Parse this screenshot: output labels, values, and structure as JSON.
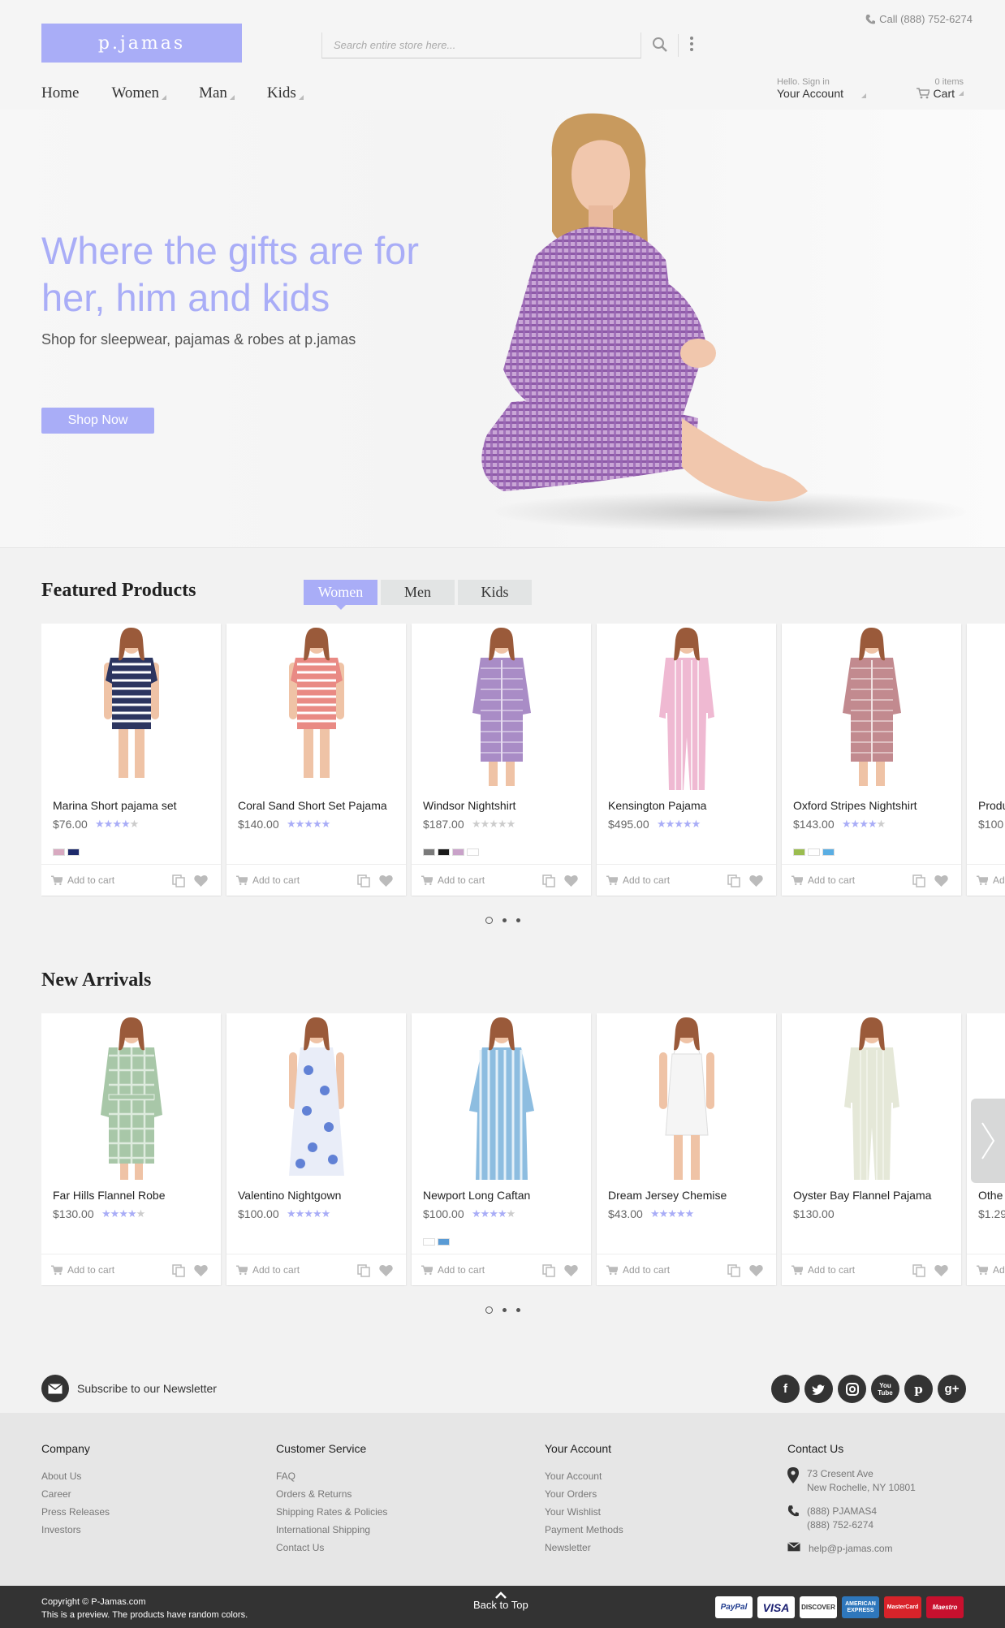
{
  "header": {
    "logo": "p.jamas",
    "search_placeholder": "Search entire store here...",
    "phone": "Call (888) 752-6274",
    "nav": [
      "Home",
      "Women",
      "Man",
      "Kids"
    ],
    "account_small": "Hello. Sign in",
    "account_label": "Your Account",
    "cart_count": "0 items",
    "cart_label": "Cart"
  },
  "hero": {
    "title": "Where the gifts are for her, him and kids",
    "subtitle": "Shop for sleepwear, pajamas & robes at p.jamas",
    "button": "Shop Now"
  },
  "featured": {
    "title": "Featured Products",
    "tabs": [
      "Women",
      "Men",
      "Kids"
    ],
    "active_tab": "Women",
    "products": [
      {
        "name": "Marina Short pajama set",
        "price": "$76.00",
        "rating": 4,
        "swatches": [
          "#d8a9c0",
          "#1d2a6b"
        ],
        "garment": "#2c3560",
        "accent": "#ffffff",
        "style": "shorts"
      },
      {
        "name": "Coral Sand Short Set Pajama",
        "price": "$140.00",
        "rating": 5,
        "swatches": [],
        "garment": "#e98a84",
        "accent": "#ffffff",
        "style": "shorts"
      },
      {
        "name": "Windsor Nightshirt",
        "price": "$187.00",
        "rating": 0,
        "swatches": [
          "#7a7a7a",
          "#1a1a1a",
          "#c9a2c9",
          "#ffffff"
        ],
        "garment": "#a98cc6",
        "accent": "#e6dbf0",
        "style": "shirt"
      },
      {
        "name": "Kensington Pajama",
        "price": "$495.00",
        "rating": 5,
        "swatches": [],
        "garment": "#efb9d2",
        "accent": "#ffffff",
        "style": "pajama"
      },
      {
        "name": "Oxford Stripes Nightshirt",
        "price": "$143.00",
        "rating": 4,
        "swatches": [
          "#9bbd4f",
          "#ffffff",
          "#5aaee3"
        ],
        "garment": "#c28a8f",
        "accent": "#f1e2e2",
        "style": "shirt"
      },
      {
        "name": "Produ",
        "price": "$100",
        "rating": 0,
        "swatches": [],
        "garment": "#dddddd",
        "accent": "#ffffff",
        "style": "none"
      }
    ]
  },
  "new_arrivals": {
    "title": "New Arrivals",
    "products": [
      {
        "name": "Far Hills Flannel Robe",
        "price": "$130.00",
        "rating": 4,
        "swatches": [],
        "garment": "#a8c7a8",
        "accent": "#e4efe4",
        "style": "robe"
      },
      {
        "name": "Valentino Nightgown",
        "price": "$100.00",
        "rating": 5,
        "swatches": [],
        "garment": "#e9edf8",
        "accent": "#4a6fd0",
        "style": "gown"
      },
      {
        "name": "Newport Long Caftan",
        "price": "$100.00",
        "rating": 4,
        "swatches": [
          "#ffffff",
          "#5a9bd5"
        ],
        "garment": "#8dbde0",
        "accent": "#e4f0f8",
        "style": "caftan"
      },
      {
        "name": "Dream Jersey Chemise",
        "price": "$43.00",
        "rating": 5,
        "swatches": [],
        "garment": "#f5f5f5",
        "accent": "#dddddd",
        "style": "chemise"
      },
      {
        "name": "Oyster Bay Flannel Pajama",
        "price": "$130.00",
        "rating": 0,
        "swatches": [],
        "garment": "#e5e8d8",
        "accent": "#f5f6ee",
        "style": "pajama"
      },
      {
        "name": "Othe",
        "price": "$1.29",
        "rating": 0,
        "swatches": [],
        "garment": "#dddddd",
        "accent": "#ffffff",
        "style": "none"
      }
    ]
  },
  "add_to_cart": "Add to cart",
  "newsletter": "Subscribe to our Newsletter",
  "social": [
    "facebook-icon",
    "twitter-icon",
    "instagram-icon",
    "youtube-icon",
    "pinterest-icon",
    "google-plus-icon"
  ],
  "footer": {
    "company": {
      "title": "Company",
      "links": [
        "About Us",
        "Career",
        "Press Releases",
        "Investors"
      ]
    },
    "service": {
      "title": "Customer Service",
      "links": [
        "FAQ",
        "Orders & Returns",
        "Shipping Rates & Policies",
        "International Shipping",
        "Contact Us"
      ]
    },
    "account": {
      "title": "Your Account",
      "links": [
        "Your Account",
        "Your Orders",
        "Your Wishlist",
        "Payment Methods",
        "Newsletter"
      ]
    },
    "contact": {
      "title": "Contact Us",
      "address1": "73 Cresent Ave",
      "address2": "New Rochelle, NY 10801",
      "phone1": "(888) PJAMAS4",
      "phone2": "(888) 752-6274",
      "email": "help@p-jamas.com"
    }
  },
  "bottom": {
    "copyright": "Copyright © P-Jamas.com",
    "note": "This is a preview. The products have random colors.",
    "back_to_top": "Back to Top",
    "payments": [
      "PayPal",
      "VISA",
      "DISCOVER",
      "AMERICAN EXPRESS",
      "MasterCard",
      "Maestro"
    ]
  },
  "colors": {
    "accent": "#a9adf7",
    "star": "#a9adf7",
    "dark": "#333333"
  }
}
